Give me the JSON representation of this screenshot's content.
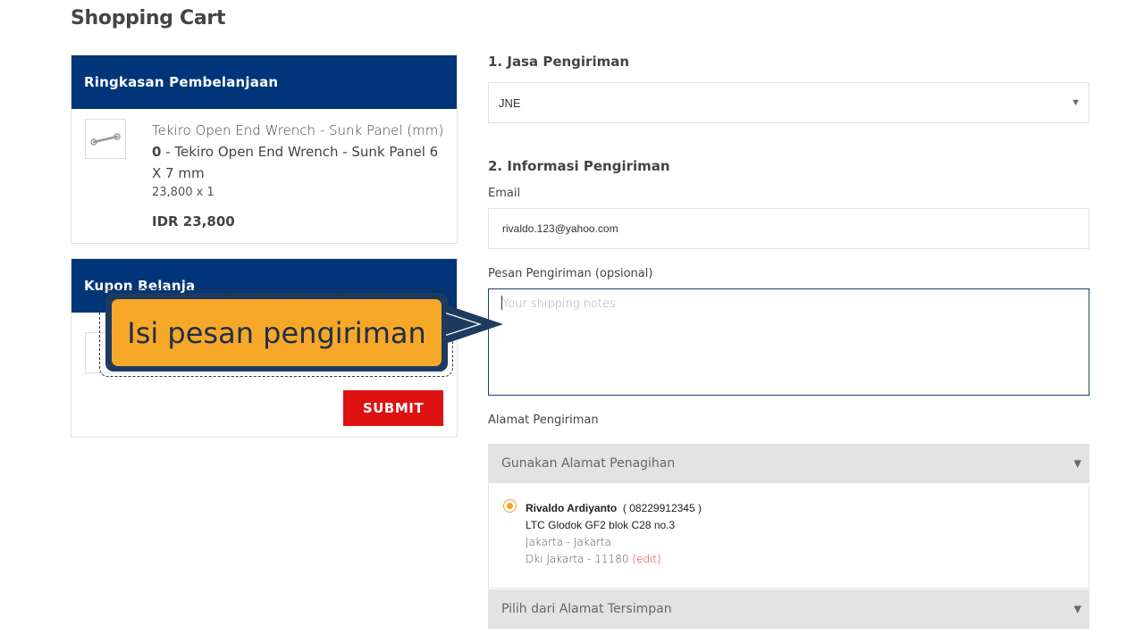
{
  "page": {
    "title": "Shopping Cart"
  },
  "summary": {
    "header": "Ringkasan Pembelanjaan",
    "item": {
      "name": "Tekiro Open End Wrench - Sunk Panel (mm)",
      "variant_qty": "0",
      "variant_name": " - Tekiro Open End Wrench - Sunk Panel 6 X 7 mm",
      "qty_line": "23,800 x 1",
      "price": "IDR 23,800"
    }
  },
  "coupon": {
    "header": "Kupon Belanja",
    "submit_label": "SUBMIT"
  },
  "callout": {
    "text": "Isi pesan pengiriman"
  },
  "shipping": {
    "section1_title": "1. Jasa Pengiriman",
    "courier": "JNE",
    "section2_title": "2. Informasi Pengiriman",
    "email_label": "Email",
    "email_value": "rivaldo.123@yahoo.com",
    "notes_label": "Pesan Pengiriman (opsional)",
    "notes_placeholder": "Your shipping notes",
    "address_label": "Alamat Pengiriman",
    "billing_option": "Gunakan Alamat Penagihan",
    "saved_option": "Pilih dari Alamat Tersimpan"
  },
  "address": {
    "name": "Rivaldo Ardiyanto",
    "phone": "( 08229912345 )",
    "street": "LTC Glodok GF2 blok C28 no.3",
    "city": "Jakarta - Jakarta",
    "province_zip": "Dki Jakarta - 11180",
    "edit_label": "(edit)"
  },
  "colors": {
    "brand_blue": "#00357a",
    "submit_red": "#dd1111",
    "callout_orange": "#f7a828"
  }
}
